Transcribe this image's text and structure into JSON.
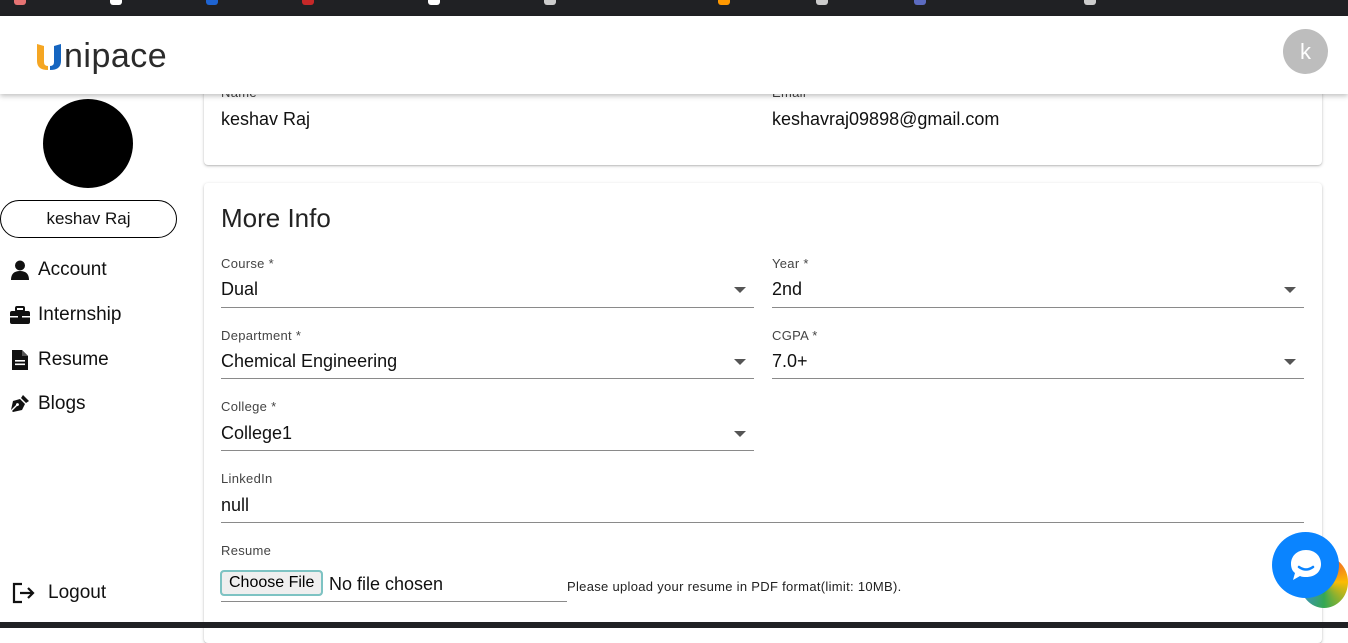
{
  "brand": {
    "logo_text": "nipace",
    "logo_colors": [
      "#f5a623",
      "#1565c0"
    ]
  },
  "user": {
    "avatar_initial": "k",
    "display_name": "keshav Raj"
  },
  "sidebar": {
    "items": [
      {
        "label": "Account",
        "icon": "person-icon"
      },
      {
        "label": "Internship",
        "icon": "briefcase-icon"
      },
      {
        "label": "Resume",
        "icon": "document-icon"
      },
      {
        "label": "Blogs",
        "icon": "pen-nib-icon"
      }
    ],
    "logout_label": "Logout"
  },
  "basic_info": {
    "name_label": "Name",
    "name_value": "keshav Raj",
    "email_label": "Email",
    "email_value": "keshavraj09898@gmail.com"
  },
  "more_info": {
    "title": "More Info",
    "course": {
      "label": "Course *",
      "value": "Dual"
    },
    "year": {
      "label": "Year *",
      "value": "2nd"
    },
    "department": {
      "label": "Department *",
      "value": "Chemical Engineering"
    },
    "cgpa": {
      "label": "CGPA *",
      "value": "7.0+"
    },
    "college": {
      "label": "College *",
      "value": "College1"
    },
    "linkedin": {
      "label": "LinkedIn",
      "value": "null"
    },
    "resume": {
      "label": "Resume",
      "button_label": "Choose File",
      "file_status": "No file chosen",
      "helper": "Please upload your resume in PDF format(limit: 10MB)."
    }
  },
  "colors": {
    "chat_button": "#0a84ff",
    "avatar_bg": "#bdbdbd"
  }
}
